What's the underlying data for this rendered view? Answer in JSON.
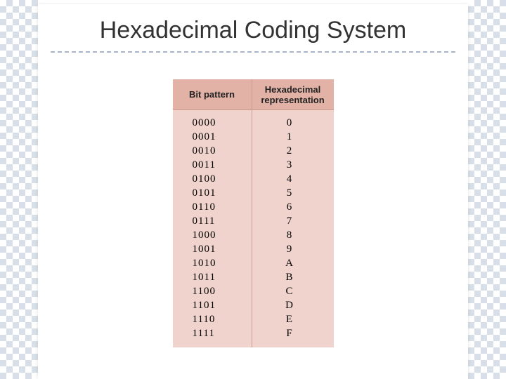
{
  "title": "Hexadecimal Coding System",
  "table": {
    "headers": {
      "bit": "Bit pattern",
      "hex_line1": "Hexadecimal",
      "hex_line2": "representation"
    },
    "rows": [
      {
        "bit": "0000",
        "hex": "0"
      },
      {
        "bit": "0001",
        "hex": "1"
      },
      {
        "bit": "0010",
        "hex": "2"
      },
      {
        "bit": "0011",
        "hex": "3"
      },
      {
        "bit": "0100",
        "hex": "4"
      },
      {
        "bit": "0101",
        "hex": "5"
      },
      {
        "bit": "0110",
        "hex": "6"
      },
      {
        "bit": "0111",
        "hex": "7"
      },
      {
        "bit": "1000",
        "hex": "8"
      },
      {
        "bit": "1001",
        "hex": "9"
      },
      {
        "bit": "1010",
        "hex": "A"
      },
      {
        "bit": "1011",
        "hex": "B"
      },
      {
        "bit": "1100",
        "hex": "C"
      },
      {
        "bit": "1101",
        "hex": "D"
      },
      {
        "bit": "1110",
        "hex": "E"
      },
      {
        "bit": "1111",
        "hex": "F"
      }
    ]
  }
}
